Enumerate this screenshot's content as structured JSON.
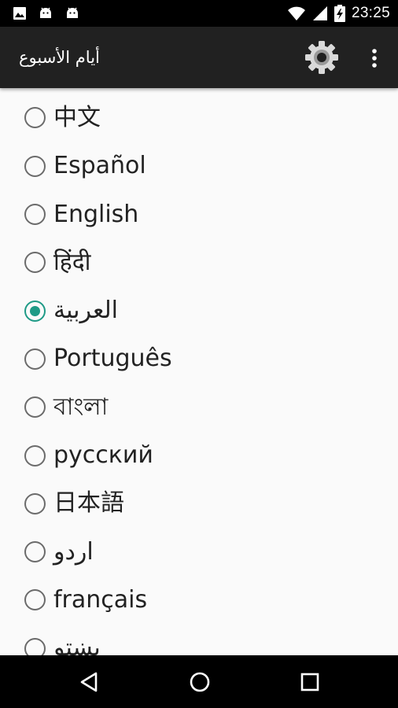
{
  "status_bar": {
    "time": "23:25",
    "left_icons": [
      "image-icon",
      "android-icon",
      "android-icon"
    ],
    "right_icons": [
      "wifi-icon",
      "cell-signal-icon",
      "battery-charging-icon"
    ]
  },
  "toolbar": {
    "title": "أيام الأسبوع",
    "settings_icon": "gear-icon",
    "more_icon": "more-vert-icon",
    "background": "#212121"
  },
  "languages": [
    {
      "label": "中文",
      "selected": false
    },
    {
      "label": "Español",
      "selected": false
    },
    {
      "label": "English",
      "selected": false
    },
    {
      "label": "हिंदी",
      "selected": false
    },
    {
      "label": "العربية",
      "selected": true
    },
    {
      "label": "Português",
      "selected": false
    },
    {
      "label": "বাংলা",
      "selected": false
    },
    {
      "label": "русский",
      "selected": false
    },
    {
      "label": "日本語",
      "selected": false
    },
    {
      "label": "اردو",
      "selected": false
    },
    {
      "label": "français",
      "selected": false
    },
    {
      "label": "پښتو",
      "selected": false
    }
  ],
  "accent_color": "#1e9a86",
  "nav_bar": {
    "buttons": [
      "back-icon",
      "home-icon",
      "recents-icon"
    ]
  }
}
